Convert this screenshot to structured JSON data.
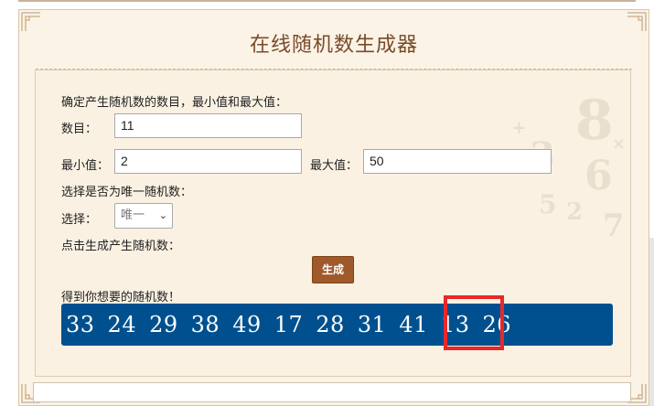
{
  "title": "在线随机数生成器",
  "intro_label": "确定产生随机数的数目，最小值和最大值：",
  "count": {
    "label": "数目：",
    "value": "11"
  },
  "min": {
    "label": "最小值：",
    "value": "2"
  },
  "max": {
    "label": "最大值：",
    "value": "50"
  },
  "unique_prompt": "选择是否为唯一随机数：",
  "unique_select": {
    "label": "选择：",
    "selected": "唯一"
  },
  "generate_prompt": "点击生成产生随机数：",
  "generate_button": "生成",
  "result_label": "得到你想要的随机数！",
  "results": [
    "33",
    "24",
    "29",
    "38",
    "49",
    "17",
    "28",
    "31",
    "41",
    "13",
    "26"
  ],
  "highlighted_result": "26",
  "colors": {
    "accent": "#a0592a",
    "result_bar": "#00508f",
    "highlight": "#e8282a",
    "title": "#7a4a2a"
  }
}
